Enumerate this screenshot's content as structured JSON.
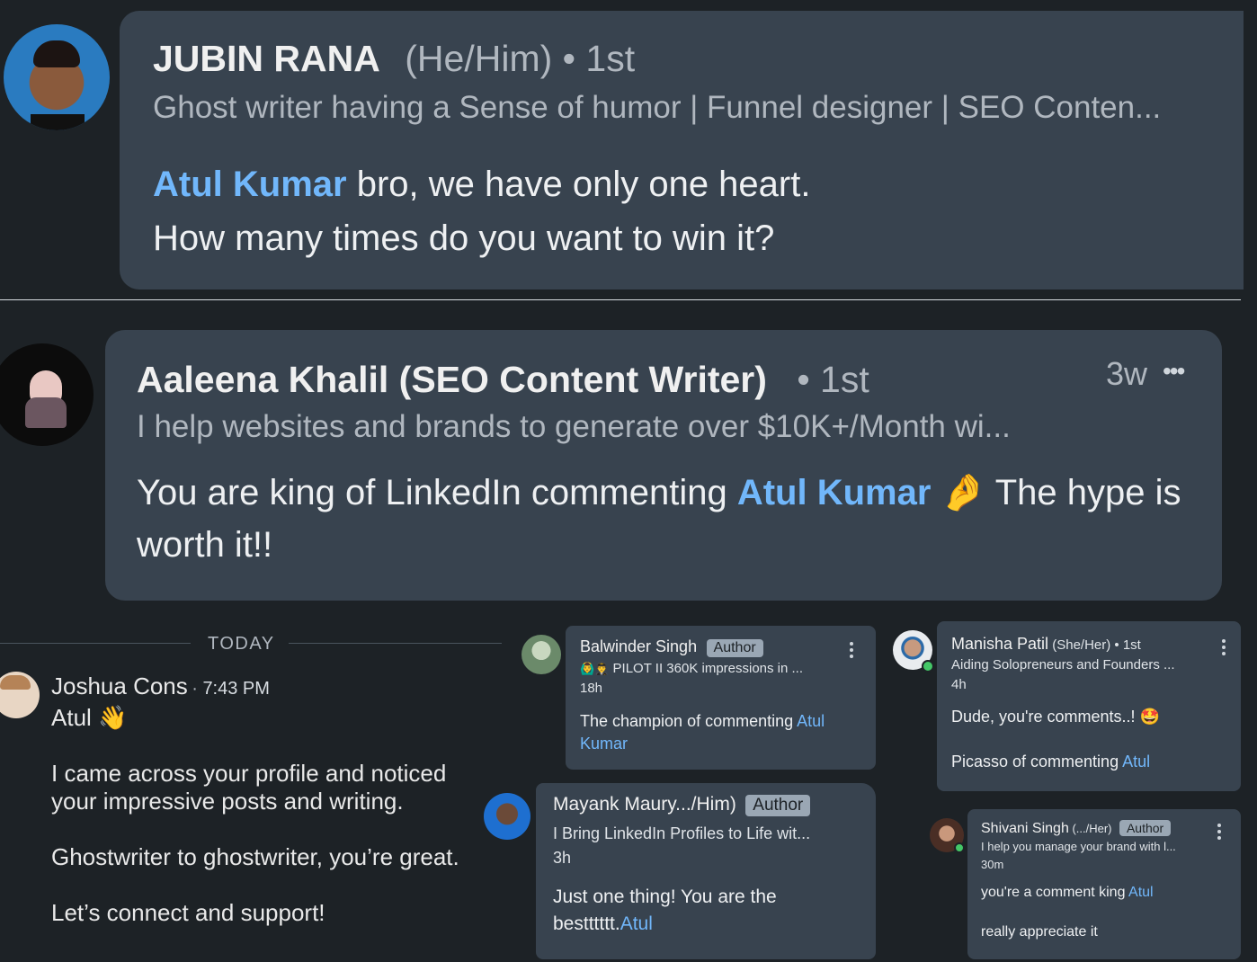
{
  "comment1": {
    "name": "JUBIN RANA",
    "pronouns": "(He/Him)",
    "degree": "• 1st",
    "headline": "Ghost writer having a Sense of humor | Funnel designer | SEO Conten...",
    "mention": "Atul Kumar",
    "text_after_mention": " bro, we have only one heart.",
    "line2": "How many times do you want to win it?"
  },
  "comment2": {
    "name": "Aaleena Khalil (SEO Content Writer)",
    "degree": "• 1st",
    "time": "3w",
    "more": "•••",
    "headline": "I help websites and brands to generate over $10K+/Month wi...",
    "text_before_mention": "You are king of LinkedIn commenting ",
    "mention": "Atul Kumar",
    "emoji": "🤌",
    "text_after": " The hype is worth it!!"
  },
  "message": {
    "divider_label": "TODAY",
    "sender": "Joshua Cons",
    "time": "7:43 PM",
    "greeting": "Atul",
    "wave_emoji": "👋",
    "p1": "I came across your profile and noticed your impressive posts and writing.",
    "p2": "Ghostwriter to ghostwriter, you’re great.",
    "p3": "Let’s connect and support!"
  },
  "small_comments": {
    "balwinder": {
      "name": "Balwinder Singh",
      "badge": "Author",
      "headline_emoji": "🙆‍♂️👨‍✈️",
      "headline": " PILOT II 360K impressions in ...",
      "time": "18h",
      "text": "The champion of commenting ",
      "mention": "Atul Kumar"
    },
    "manisha": {
      "name": "Manisha Patil",
      "pronouns": " (She/Her) • 1st",
      "headline": "Aiding Solopreneurs and Founders ...",
      "time": "4h",
      "line1": "Dude, you're comments..! 🤩",
      "line2": "Picasso of commenting ",
      "mention": "Atul"
    },
    "mayank": {
      "name": "Mayank Maury.../Him)",
      "badge": "Author",
      "headline": "I Bring LinkedIn Profiles to Life wit...",
      "time": "3h",
      "text": "Just one thing! You are the bestttttt.",
      "mention": "Atul"
    },
    "shivani": {
      "name": "Shivani Singh",
      "pronouns": " (.../Her)",
      "badge": "Author",
      "headline": "I help you manage your brand with l...",
      "time": "30m",
      "line1": "you're a comment king ",
      "mention": "Atul",
      "line2": "really appreciate it"
    }
  }
}
